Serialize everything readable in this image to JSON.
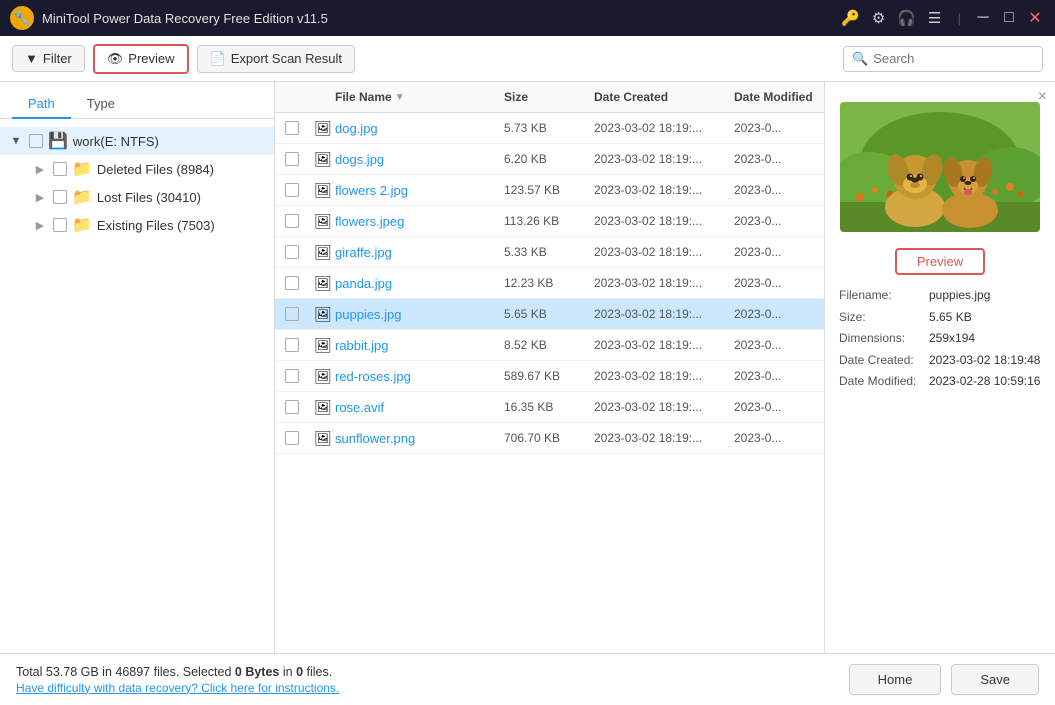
{
  "app": {
    "title": "MiniTool Power Data Recovery Free Edition v11.5",
    "icons": [
      "key",
      "circle",
      "headphones",
      "menu",
      "minimize",
      "maximize",
      "close"
    ]
  },
  "toolbar": {
    "filter_label": "Filter",
    "preview_label": "Preview",
    "export_label": "Export Scan Result",
    "search_placeholder": "Search"
  },
  "tabs": {
    "path_label": "Path",
    "type_label": "Type"
  },
  "tree": {
    "root": {
      "label": "work(E: NTFS)",
      "expanded": true,
      "children": [
        {
          "label": "Deleted Files (8984)",
          "type": "deleted"
        },
        {
          "label": "Lost Files (30410)",
          "type": "lost"
        },
        {
          "label": "Existing Files (7503)",
          "type": "existing"
        }
      ]
    }
  },
  "file_list": {
    "headers": {
      "name": "File Name",
      "size": "Size",
      "date_created": "Date Created",
      "date_modified": "Date Modified"
    },
    "files": [
      {
        "name": "dog.jpg",
        "size": "5.73 KB",
        "date_created": "2023-03-02 18:19:...",
        "date_modified": "2023-0...",
        "selected": false
      },
      {
        "name": "dogs.jpg",
        "size": "6.20 KB",
        "date_created": "2023-03-02 18:19:...",
        "date_modified": "2023-0...",
        "selected": false
      },
      {
        "name": "flowers 2.jpg",
        "size": "123.57 KB",
        "date_created": "2023-03-02 18:19:...",
        "date_modified": "2023-0...",
        "selected": false
      },
      {
        "name": "flowers.jpeg",
        "size": "113.26 KB",
        "date_created": "2023-03-02 18:19:...",
        "date_modified": "2023-0...",
        "selected": false
      },
      {
        "name": "giraffe.jpg",
        "size": "5.33 KB",
        "date_created": "2023-03-02 18:19:...",
        "date_modified": "2023-0...",
        "selected": false
      },
      {
        "name": "panda.jpg",
        "size": "12.23 KB",
        "date_created": "2023-03-02 18:19:...",
        "date_modified": "2023-0...",
        "selected": false
      },
      {
        "name": "puppies.jpg",
        "size": "5.65 KB",
        "date_created": "2023-03-02 18:19:...",
        "date_modified": "2023-0...",
        "selected": true
      },
      {
        "name": "rabbit.jpg",
        "size": "8.52 KB",
        "date_created": "2023-03-02 18:19:...",
        "date_modified": "2023-0...",
        "selected": false
      },
      {
        "name": "red-roses.jpg",
        "size": "589.67 KB",
        "date_created": "2023-03-02 18:19:...",
        "date_modified": "2023-0...",
        "selected": false
      },
      {
        "name": "rose.avif",
        "size": "16.35 KB",
        "date_created": "2023-03-02 18:19:...",
        "date_modified": "2023-0...",
        "selected": false
      },
      {
        "name": "sunflower.png",
        "size": "706.70 KB",
        "date_created": "2023-03-02 18:19:...",
        "date_modified": "2023-0...",
        "selected": false
      }
    ]
  },
  "preview": {
    "button_label": "Preview",
    "close_symbol": "×",
    "filename_label": "Filename:",
    "filename_value": "puppies.jpg",
    "size_label": "Size:",
    "size_value": "5.65 KB",
    "dimensions_label": "Dimensions:",
    "dimensions_value": "259x194",
    "date_created_label": "Date Created:",
    "date_created_value": "2023-03-02 18:19:48",
    "date_modified_label": "Date Modified:",
    "date_modified_value": "2023-02-28 10:59:16"
  },
  "statusbar": {
    "summary": "Total 53.78 GB in 46897 files.  Selected ",
    "selected_bytes": "0 Bytes",
    "in_text": " in ",
    "selected_files": "0",
    "files_suffix": " files.",
    "help_link": "Have difficulty with data recovery? Click here for instructions.",
    "home_label": "Home",
    "save_label": "Save"
  }
}
